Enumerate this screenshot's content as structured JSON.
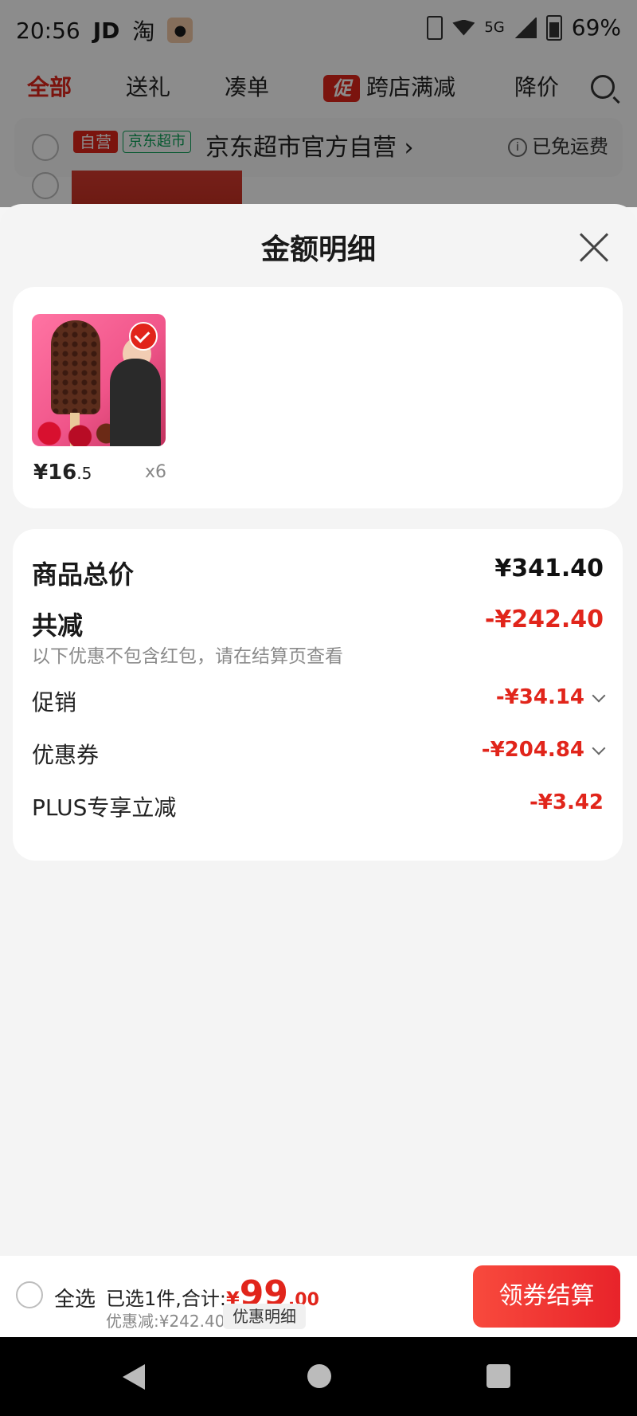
{
  "status_bar": {
    "time": "20:56",
    "carrier_label": "JD",
    "taobao_icon": "淘",
    "network": "5G",
    "battery": "69%"
  },
  "tabs": [
    {
      "label": "全部",
      "active": true
    },
    {
      "label": "送礼",
      "active": false
    },
    {
      "label": "凑单",
      "active": false
    },
    {
      "label": "跨店满减",
      "active": false,
      "badge": "促"
    },
    {
      "label": "降价",
      "active": false
    }
  ],
  "store": {
    "self_tag": "自营",
    "market_tag": "京东超市",
    "name": "京东超市官方自营 ›",
    "shipping": "已免运费"
  },
  "sheet": {
    "title": "金额明细",
    "product": {
      "price_int": "¥16",
      "price_dec": ".5",
      "quantity": "x6"
    },
    "summary": {
      "total_label": "商品总价",
      "total_value": "¥341.40",
      "reduction_label": "共减",
      "reduction_value": "-¥242.40",
      "reduction_note": "以下优惠不包含红包，请在结算页查看",
      "items": [
        {
          "label": "促销",
          "value": "-¥34.14",
          "expandable": true
        },
        {
          "label": "优惠券",
          "value": "-¥204.84",
          "expandable": true
        },
        {
          "label": "PLUS专享立减",
          "value": "-¥3.42",
          "expandable": false
        }
      ]
    }
  },
  "bottom_bar": {
    "select_all": "全选",
    "selected_text": "已选1件,合计:",
    "total_yen": "¥",
    "total_int": "99",
    "total_dec": ".00",
    "discount_text": "优惠减:¥242.40",
    "detail_chip": "优惠明细",
    "checkout": "领券结算"
  },
  "colors": {
    "accent_red": "#e1251b",
    "market_green": "#0aa057",
    "sheet_bg": "#f4f4f4"
  }
}
